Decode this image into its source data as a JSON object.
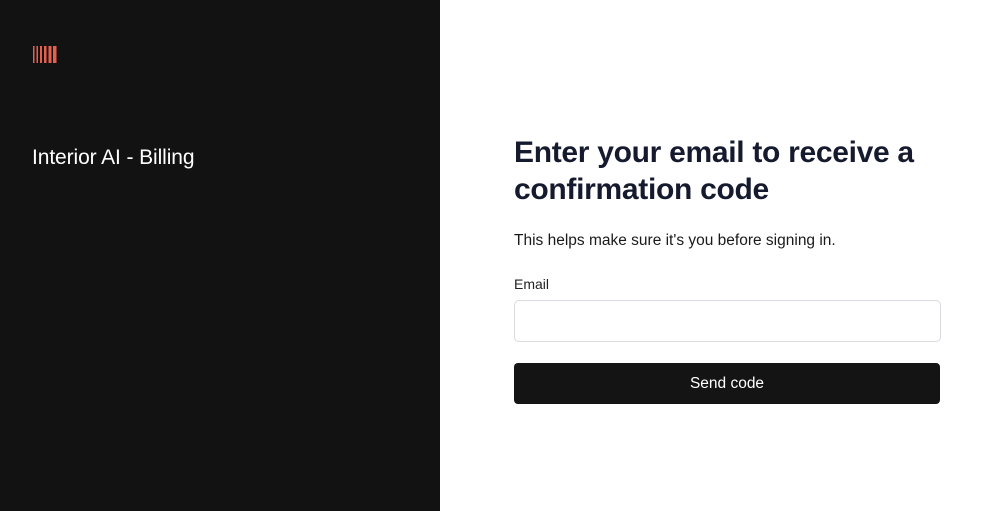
{
  "brand": {
    "logo_icon": "barcode-stripes-icon",
    "logo_color": "#e8604c",
    "title": "Interior AI - Billing"
  },
  "form": {
    "heading": "Enter your email to receive a confirmation code",
    "subtext": "This helps make sure it's you before signing in.",
    "email_label": "Email",
    "email_value": "",
    "email_placeholder": "",
    "submit_label": "Send code"
  },
  "colors": {
    "left_panel_bg": "#121212",
    "right_panel_bg": "#ffffff",
    "button_bg": "#141414",
    "heading_color": "#161a2e"
  }
}
